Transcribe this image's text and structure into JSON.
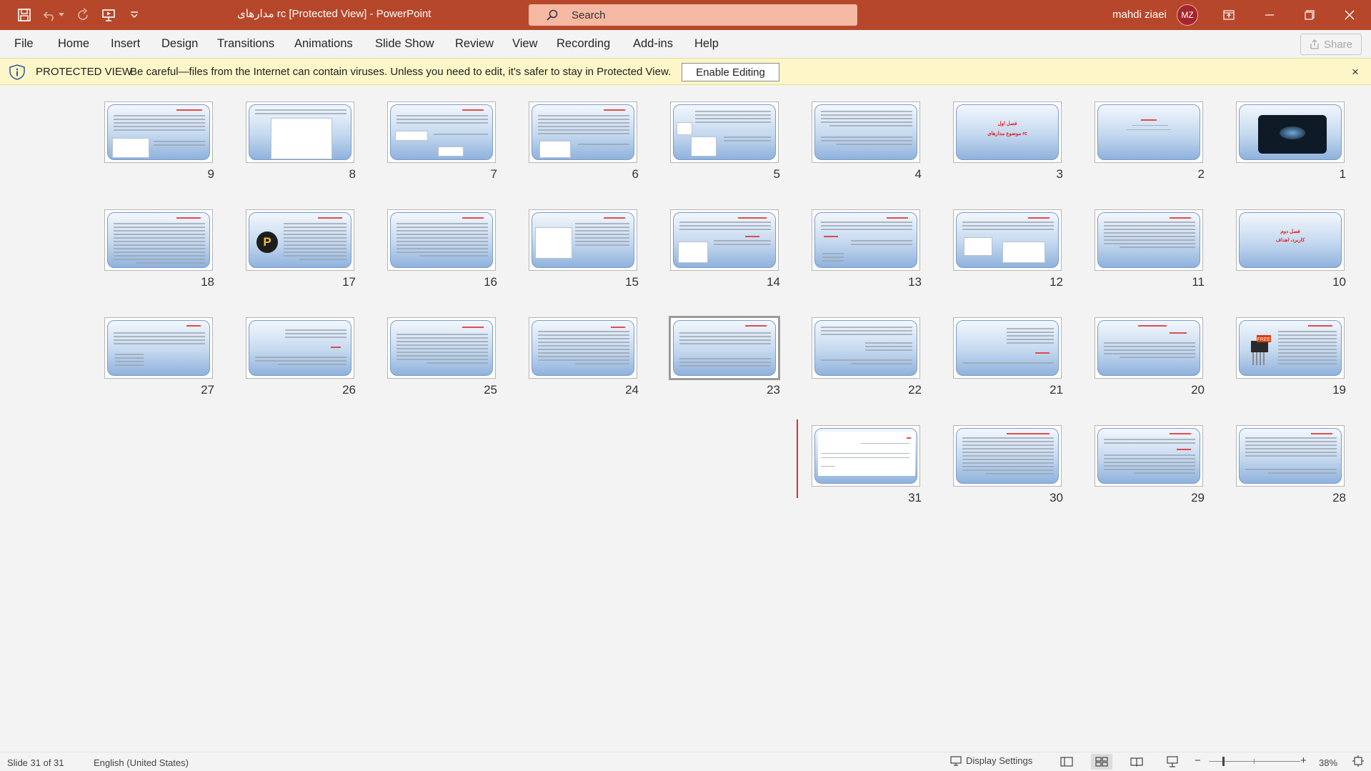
{
  "titlebar": {
    "document_title": "مدارهای rc  [Protected View]  -  PowerPoint",
    "search_placeholder": "Search",
    "user_name": "mahdi ziaei",
    "user_initials": "MZ",
    "accent_color": "#b7472a"
  },
  "menu": {
    "items": [
      "File",
      "Home",
      "Insert",
      "Design",
      "Transitions",
      "Animations",
      "Slide Show",
      "Review",
      "View",
      "Recording",
      "Add-ins",
      "Help"
    ],
    "share_label": "Share"
  },
  "protected_view": {
    "title": "PROTECTED VIEW",
    "message": "Be careful—files from the Internet can contain viruses. Unless you need to edit, it's safer to stay in Protected View.",
    "button_label": "Enable Editing",
    "close_glyph": "×"
  },
  "slides": {
    "numbers": [
      "1",
      "2",
      "3",
      "4",
      "5",
      "6",
      "7",
      "8",
      "9",
      "10",
      "11",
      "12",
      "13",
      "14",
      "15",
      "16",
      "17",
      "18",
      "19",
      "20",
      "21",
      "22",
      "23",
      "24",
      "25",
      "26",
      "27",
      "28",
      "29",
      "30",
      "31"
    ],
    "selected": "23",
    "slide3_title": "فصل اول",
    "slide3_subtitle": "موضوع مدارهای rc",
    "slide10_title": "فصل دوم",
    "slide10_subtitle": "کاربرد، اهداف",
    "slide17_logo": "P",
    "slide19_badge": "FREE"
  },
  "statusbar": {
    "slide_counter": "Slide 31 of 31",
    "language": "English (United States)",
    "display_settings": "Display Settings",
    "zoom": "38%",
    "zoom_fraction": 0.38
  }
}
